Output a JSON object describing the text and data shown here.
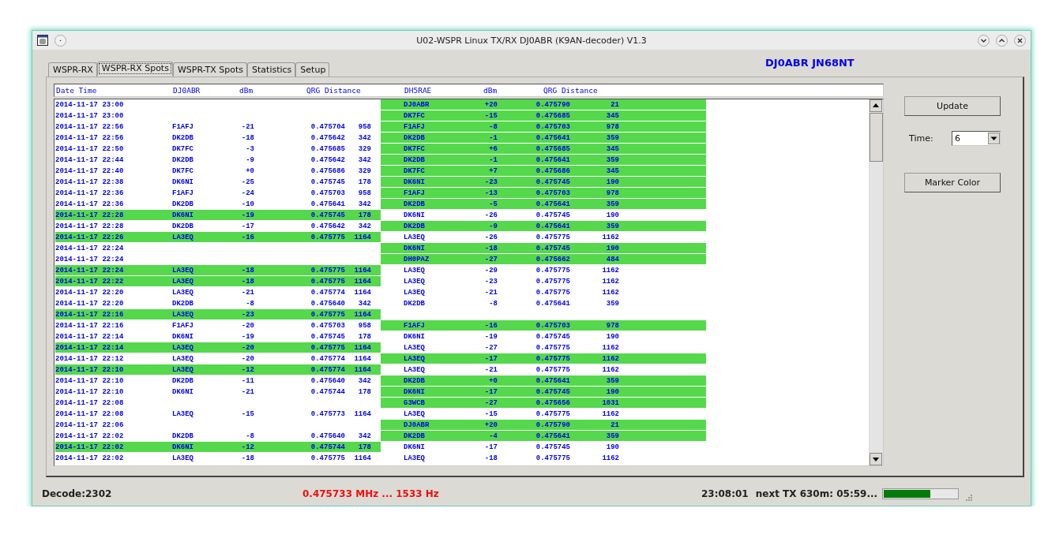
{
  "window": {
    "title": "U02-WSPR Linux TX/RX DJ0ABR (K9AN-decoder) V1.3"
  },
  "tabs": [
    {
      "label": "WSPR-RX",
      "selected": false
    },
    {
      "label": "WSPR-RX Spots",
      "selected": true
    },
    {
      "label": "WSPR-TX Spots",
      "selected": false
    },
    {
      "label": "Statistics",
      "selected": false
    },
    {
      "label": "Setup",
      "selected": false
    }
  ],
  "station": "DJ0ABR JN68NT",
  "spots": {
    "columns": [
      "Date Time",
      "DJ0ABR",
      "dBm",
      "QRG Distance",
      "DH5RAE",
      "dBm",
      "QRG Distance"
    ],
    "rows": [
      {
        "date": "2014-11-17 23:00",
        "left_highlighted": false,
        "right_highlighted": true,
        "right": {
          "call": "DJ0ABR",
          "dbm": "+20",
          "qrg": "0.475790",
          "distance": "21"
        }
      },
      {
        "date": "2014-11-17 23:00",
        "left_highlighted": false,
        "right_highlighted": true,
        "right": {
          "call": "DK7FC",
          "dbm": "-15",
          "qrg": "0.475685",
          "distance": "345"
        }
      },
      {
        "date": "2014-11-17 22:56",
        "left_highlighted": false,
        "left": {
          "call": "F1AFJ",
          "dbm": "-21",
          "qrg": "0.475704",
          "distance": "958"
        },
        "right_highlighted": true,
        "right": {
          "call": "F1AFJ",
          "dbm": "-8",
          "qrg": "0.475703",
          "distance": "978"
        }
      },
      {
        "date": "2014-11-17 22:56",
        "left_highlighted": false,
        "left": {
          "call": "DK2DB",
          "dbm": "-18",
          "qrg": "0.475642",
          "distance": "342"
        },
        "right_highlighted": true,
        "right": {
          "call": "DK2DB",
          "dbm": "-1",
          "qrg": "0.475641",
          "distance": "359"
        }
      },
      {
        "date": "2014-11-17 22:50",
        "left_highlighted": false,
        "left": {
          "call": "DK7FC",
          "dbm": "-3",
          "qrg": "0.475685",
          "distance": "329"
        },
        "right_highlighted": true,
        "right": {
          "call": "DK7FC",
          "dbm": "+6",
          "qrg": "0.475685",
          "distance": "345"
        }
      },
      {
        "date": "2014-11-17 22:44",
        "left_highlighted": false,
        "left": {
          "call": "DK2DB",
          "dbm": "-9",
          "qrg": "0.475642",
          "distance": "342"
        },
        "right_highlighted": true,
        "right": {
          "call": "DK2DB",
          "dbm": "-1",
          "qrg": "0.475641",
          "distance": "359"
        }
      },
      {
        "date": "2014-11-17 22:40",
        "left_highlighted": false,
        "left": {
          "call": "DK7FC",
          "dbm": "+0",
          "qrg": "0.475686",
          "distance": "329"
        },
        "right_highlighted": true,
        "right": {
          "call": "DK7FC",
          "dbm": "+7",
          "qrg": "0.475686",
          "distance": "345"
        }
      },
      {
        "date": "2014-11-17 22:38",
        "left_highlighted": false,
        "left": {
          "call": "DK6NI",
          "dbm": "-25",
          "qrg": "0.475745",
          "distance": "178"
        },
        "right_highlighted": true,
        "right": {
          "call": "DK6NI",
          "dbm": "-23",
          "qrg": "0.475745",
          "distance": "190"
        }
      },
      {
        "date": "2014-11-17 22:36",
        "left_highlighted": false,
        "left": {
          "call": "F1AFJ",
          "dbm": "-24",
          "qrg": "0.475703",
          "distance": "958"
        },
        "right_highlighted": true,
        "right": {
          "call": "F1AFJ",
          "dbm": "-13",
          "qrg": "0.475703",
          "distance": "978"
        }
      },
      {
        "date": "2014-11-17 22:36",
        "left_highlighted": false,
        "left": {
          "call": "DK2DB",
          "dbm": "-10",
          "qrg": "0.475641",
          "distance": "342"
        },
        "right_highlighted": true,
        "right": {
          "call": "DK2DB",
          "dbm": "-5",
          "qrg": "0.475641",
          "distance": "359"
        }
      },
      {
        "date": "2014-11-17 22:28",
        "left_highlighted": true,
        "left": {
          "call": "DK6NI",
          "dbm": "-19",
          "qrg": "0.475745",
          "distance": "178"
        },
        "right_highlighted": false,
        "right": {
          "call": "DK6NI",
          "dbm": "-26",
          "qrg": "0.475745",
          "distance": "190"
        }
      },
      {
        "date": "2014-11-17 22:28",
        "left_highlighted": false,
        "left": {
          "call": "DK2DB",
          "dbm": "-17",
          "qrg": "0.475642",
          "distance": "342"
        },
        "right_highlighted": true,
        "right": {
          "call": "DK2DB",
          "dbm": "-9",
          "qrg": "0.475641",
          "distance": "359"
        }
      },
      {
        "date": "2014-11-17 22:26",
        "left_highlighted": true,
        "left": {
          "call": "LA3EQ",
          "dbm": "-16",
          "qrg": "0.475775",
          "distance": "1164"
        },
        "right_highlighted": false,
        "right": {
          "call": "LA3EQ",
          "dbm": "-26",
          "qrg": "0.475775",
          "distance": "1162"
        }
      },
      {
        "date": "2014-11-17 22:24",
        "left_highlighted": false,
        "right_highlighted": true,
        "right": {
          "call": "DK6NI",
          "dbm": "-18",
          "qrg": "0.475745",
          "distance": "190"
        }
      },
      {
        "date": "2014-11-17 22:24",
        "left_highlighted": false,
        "right_highlighted": true,
        "right": {
          "call": "DH0PAZ",
          "dbm": "-27",
          "qrg": "0.475662",
          "distance": "484"
        }
      },
      {
        "date": "2014-11-17 22:24",
        "left_highlighted": true,
        "left": {
          "call": "LA3EQ",
          "dbm": "-18",
          "qrg": "0.475775",
          "distance": "1164"
        },
        "right_highlighted": false,
        "right": {
          "call": "LA3EQ",
          "dbm": "-29",
          "qrg": "0.475775",
          "distance": "1162"
        }
      },
      {
        "date": "2014-11-17 22:22",
        "left_highlighted": true,
        "left": {
          "call": "LA3EQ",
          "dbm": "-18",
          "qrg": "0.475775",
          "distance": "1164"
        },
        "right_highlighted": false,
        "right": {
          "call": "LA3EQ",
          "dbm": "-23",
          "qrg": "0.475775",
          "distance": "1162"
        }
      },
      {
        "date": "2014-11-17 22:20",
        "left_highlighted": false,
        "left": {
          "call": "LA3EQ",
          "dbm": "-21",
          "qrg": "0.475774",
          "distance": "1164"
        },
        "right_highlighted": false,
        "right": {
          "call": "LA3EQ",
          "dbm": "-21",
          "qrg": "0.475775",
          "distance": "1162"
        }
      },
      {
        "date": "2014-11-17 22:20",
        "left_highlighted": false,
        "left": {
          "call": "DK2DB",
          "dbm": "-8",
          "qrg": "0.475640",
          "distance": "342"
        },
        "right_highlighted": false,
        "right": {
          "call": "DK2DB",
          "dbm": "-8",
          "qrg": "0.475641",
          "distance": "359"
        }
      },
      {
        "date": "2014-11-17 22:16",
        "left_highlighted": true,
        "left": {
          "call": "LA3EQ",
          "dbm": "-23",
          "qrg": "0.475775",
          "distance": "1164"
        },
        "right_highlighted": false
      },
      {
        "date": "2014-11-17 22:16",
        "left_highlighted": false,
        "left": {
          "call": "F1AFJ",
          "dbm": "-20",
          "qrg": "0.475703",
          "distance": "958"
        },
        "right_highlighted": true,
        "right": {
          "call": "F1AFJ",
          "dbm": "-16",
          "qrg": "0.475703",
          "distance": "978"
        }
      },
      {
        "date": "2014-11-17 22:14",
        "left_highlighted": false,
        "left": {
          "call": "DK6NI",
          "dbm": "-19",
          "qrg": "0.475745",
          "distance": "178"
        },
        "right_highlighted": false,
        "right": {
          "call": "DK6NI",
          "dbm": "-19",
          "qrg": "0.475745",
          "distance": "190"
        }
      },
      {
        "date": "2014-11-17 22:14",
        "left_highlighted": true,
        "left": {
          "call": "LA3EQ",
          "dbm": "-20",
          "qrg": "0.475775",
          "distance": "1164"
        },
        "right_highlighted": false,
        "right": {
          "call": "LA3EQ",
          "dbm": "-27",
          "qrg": "0.475775",
          "distance": "1162"
        }
      },
      {
        "date": "2014-11-17 22:12",
        "left_highlighted": false,
        "left": {
          "call": "LA3EQ",
          "dbm": "-20",
          "qrg": "0.475774",
          "distance": "1164"
        },
        "right_highlighted": true,
        "right": {
          "call": "LA3EQ",
          "dbm": "-17",
          "qrg": "0.475775",
          "distance": "1162"
        }
      },
      {
        "date": "2014-11-17 22:10",
        "left_highlighted": true,
        "left": {
          "call": "LA3EQ",
          "dbm": "-12",
          "qrg": "0.475774",
          "distance": "1164"
        },
        "right_highlighted": false,
        "right": {
          "call": "LA3EQ",
          "dbm": "-21",
          "qrg": "0.475775",
          "distance": "1162"
        }
      },
      {
        "date": "2014-11-17 22:10",
        "left_highlighted": false,
        "left": {
          "call": "DK2DB",
          "dbm": "-11",
          "qrg": "0.475640",
          "distance": "342"
        },
        "right_highlighted": true,
        "right": {
          "call": "DK2DB",
          "dbm": "+0",
          "qrg": "0.475641",
          "distance": "359"
        }
      },
      {
        "date": "2014-11-17 22:10",
        "left_highlighted": false,
        "left": {
          "call": "DK6NI",
          "dbm": "-21",
          "qrg": "0.475744",
          "distance": "178"
        },
        "right_highlighted": true,
        "right": {
          "call": "DK6NI",
          "dbm": "-17",
          "qrg": "0.475745",
          "distance": "190"
        }
      },
      {
        "date": "2014-11-17 22:08",
        "left_highlighted": false,
        "right_highlighted": true,
        "right": {
          "call": "G3WCB",
          "dbm": "-27",
          "qrg": "0.475656",
          "distance": "1031"
        }
      },
      {
        "date": "2014-11-17 22:08",
        "left_highlighted": false,
        "left": {
          "call": "LA3EQ",
          "dbm": "-15",
          "qrg": "0.475773",
          "distance": "1164"
        },
        "right_highlighted": false,
        "right": {
          "call": "LA3EQ",
          "dbm": "-15",
          "qrg": "0.475775",
          "distance": "1162"
        }
      },
      {
        "date": "2014-11-17 22:06",
        "left_highlighted": false,
        "right_highlighted": true,
        "right": {
          "call": "DJ0ABR",
          "dbm": "+20",
          "qrg": "0.475790",
          "distance": "21"
        }
      },
      {
        "date": "2014-11-17 22:02",
        "left_highlighted": false,
        "left": {
          "call": "DK2DB",
          "dbm": "-8",
          "qrg": "0.475640",
          "distance": "342"
        },
        "right_highlighted": true,
        "right": {
          "call": "DK2DB",
          "dbm": "-4",
          "qrg": "0.475641",
          "distance": "359"
        }
      },
      {
        "date": "2014-11-17 22:02",
        "left_highlighted": true,
        "left": {
          "call": "DK6NI",
          "dbm": "-12",
          "qrg": "0.475744",
          "distance": "178"
        },
        "right_highlighted": false,
        "right": {
          "call": "DK6NI",
          "dbm": "-17",
          "qrg": "0.475745",
          "distance": "190"
        }
      },
      {
        "date": "2014-11-17 22:02",
        "left_highlighted": false,
        "left": {
          "call": "LA3EQ",
          "dbm": "-18",
          "qrg": "0.475775",
          "distance": "1164"
        },
        "right_highlighted": false,
        "right": {
          "call": "LA3EQ",
          "dbm": "-18",
          "qrg": "0.475775",
          "distance": "1162"
        }
      }
    ]
  },
  "controls": {
    "update_button": "Update",
    "time_label": "Time:",
    "time_value": "6",
    "marker_button": "Marker Color"
  },
  "status_bar": {
    "decode": "Decode:2302",
    "frequency": "0.475733 MHz ... 1533 Hz",
    "clock": "23:08:01",
    "next_tx": "next TX 630m: 05:59...",
    "progress": {
      "level": 0.63
    }
  }
}
